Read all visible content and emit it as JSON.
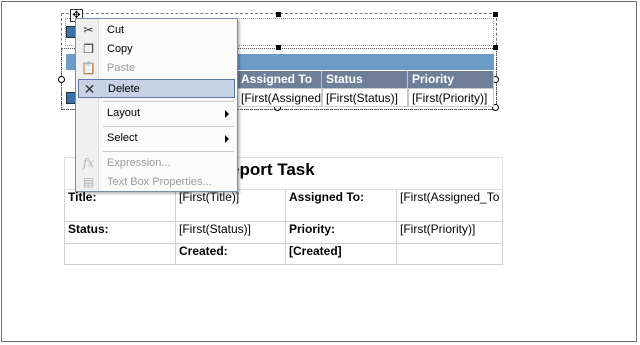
{
  "top_table": {
    "headers": [
      "Assigned To",
      "Status",
      "Priority"
    ],
    "cells": [
      "[First(Assigned_",
      "[First(Status)]",
      "[First(Priority)]"
    ]
  },
  "report2": {
    "title_partial": "eport Task",
    "row1": {
      "label1": "Title:",
      "value1": "[First(Title)]",
      "label2": "Assigned To:",
      "value2": "[First(Assigned_To"
    },
    "row2": {
      "label1": "Status:",
      "value1": "[First(Status)]",
      "label2": "Priority:",
      "value2": "[First(Priority)]"
    },
    "row3": {
      "label1": "Created:",
      "value1": "[Created]"
    }
  },
  "context_menu": {
    "items": [
      {
        "label": "Cut",
        "icon": "scissors-icon",
        "enabled": true
      },
      {
        "label": "Copy",
        "icon": "copy-icon",
        "enabled": true
      },
      {
        "label": "Paste",
        "icon": "paste-icon",
        "enabled": false
      },
      {
        "label": "Delete",
        "icon": "delete-icon",
        "enabled": true,
        "highlighted": true
      },
      {
        "label": "Layout",
        "submenu": true,
        "enabled": true
      },
      {
        "label": "Select",
        "submenu": true,
        "enabled": true
      },
      {
        "label": "Expression...",
        "icon": "fx-icon",
        "enabled": false
      },
      {
        "label": "Text Box Properties...",
        "icon": "properties-icon",
        "enabled": false
      }
    ]
  },
  "colors": {
    "header_band": "#6d9bc7",
    "header_cells": "#6f7f99",
    "menu_highlight": "#c7d3e5"
  }
}
